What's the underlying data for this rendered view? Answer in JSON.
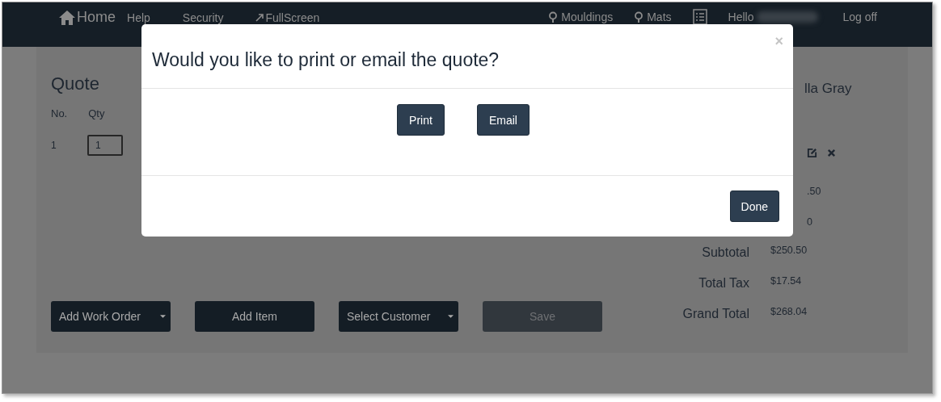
{
  "navbar": {
    "brand": "Home",
    "links": [
      {
        "kind": "plain",
        "label": "Help"
      },
      {
        "kind": "plain",
        "label": "Security"
      },
      {
        "kind": "external",
        "label": "FullScreen"
      }
    ],
    "right": [
      {
        "kind": "search",
        "label": "Mouldings"
      },
      {
        "kind": "search",
        "label": "Mats"
      },
      {
        "kind": "list"
      },
      {
        "kind": "greeting",
        "label": "Hello"
      },
      {
        "kind": "link",
        "label": "Log off"
      }
    ]
  },
  "quote": {
    "title": "Quote",
    "columns": [
      "No.",
      "Qty"
    ],
    "rows": [
      {
        "no": "1",
        "qty": "1"
      }
    ],
    "customer": "lla Gray",
    "partial_amounts": [
      ".50",
      "0"
    ],
    "totals": [
      {
        "label": "Subtotal",
        "value": "$250.50"
      },
      {
        "label": "Total Tax",
        "value": "$17.54"
      },
      {
        "label": "Grand Total",
        "value": "$268.04"
      }
    ],
    "buttons": [
      {
        "label": "Add Work Order",
        "dropdown": true,
        "disabled": false
      },
      {
        "label": "Add Item",
        "dropdown": false,
        "disabled": false
      },
      {
        "label": "Select Customer",
        "dropdown": true,
        "disabled": false
      },
      {
        "label": "Save",
        "dropdown": false,
        "disabled": true
      }
    ]
  },
  "modal": {
    "title": "Would you like to print or email the quote?",
    "close": "×",
    "actions": [
      "Print",
      "Email"
    ],
    "footer_button": "Done"
  }
}
